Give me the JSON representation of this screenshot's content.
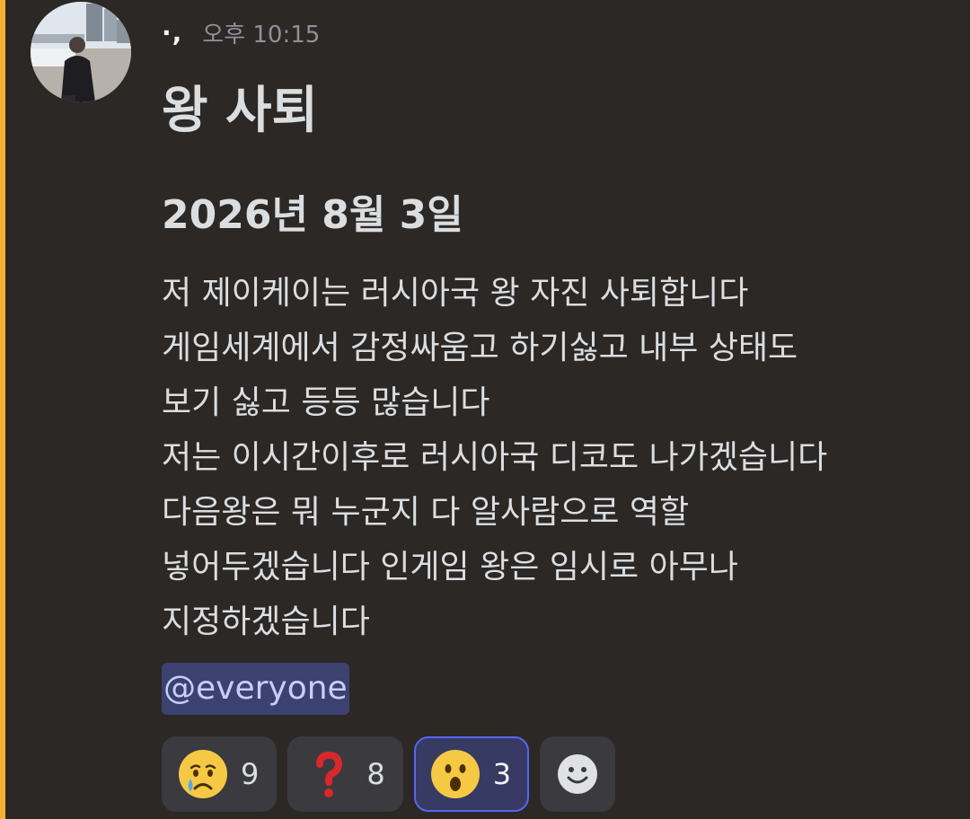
{
  "message": {
    "author": "·,",
    "timestamp": "오후 10:15",
    "heading1": "왕 사퇴",
    "heading2": "2026년 8월 3일",
    "lines": [
      "저 제이케이는 러시아국 왕 자진 사퇴합니다",
      "게임세계에서 감정싸움고 하기싫고 내부 상태도",
      "보기 싫고 등등 많습니다",
      "저는 이시간이후로 러시아국 디코도 나가겠습니다",
      "다음왕은 뭐 누군지 다 알사람으로 역할",
      "넣어두겠습니다 인게임 왕은 임시로 아무나",
      "지정하겠습니다"
    ],
    "mention": "@everyone"
  },
  "reactions": [
    {
      "icon": "crying-face-icon",
      "count": "9",
      "active": false
    },
    {
      "icon": "red-question-mark-icon",
      "count": "8",
      "active": false
    },
    {
      "icon": "surprised-face-icon",
      "count": "3",
      "active": true
    }
  ],
  "add_reaction_icon": "add-reaction-smiley-icon",
  "colors": {
    "background": "#2b2826",
    "mention_bar": "#f0b232",
    "mention_bg": "#3c4270",
    "mention_text": "#c9cdfb",
    "active_reaction_border": "#5865f2"
  }
}
